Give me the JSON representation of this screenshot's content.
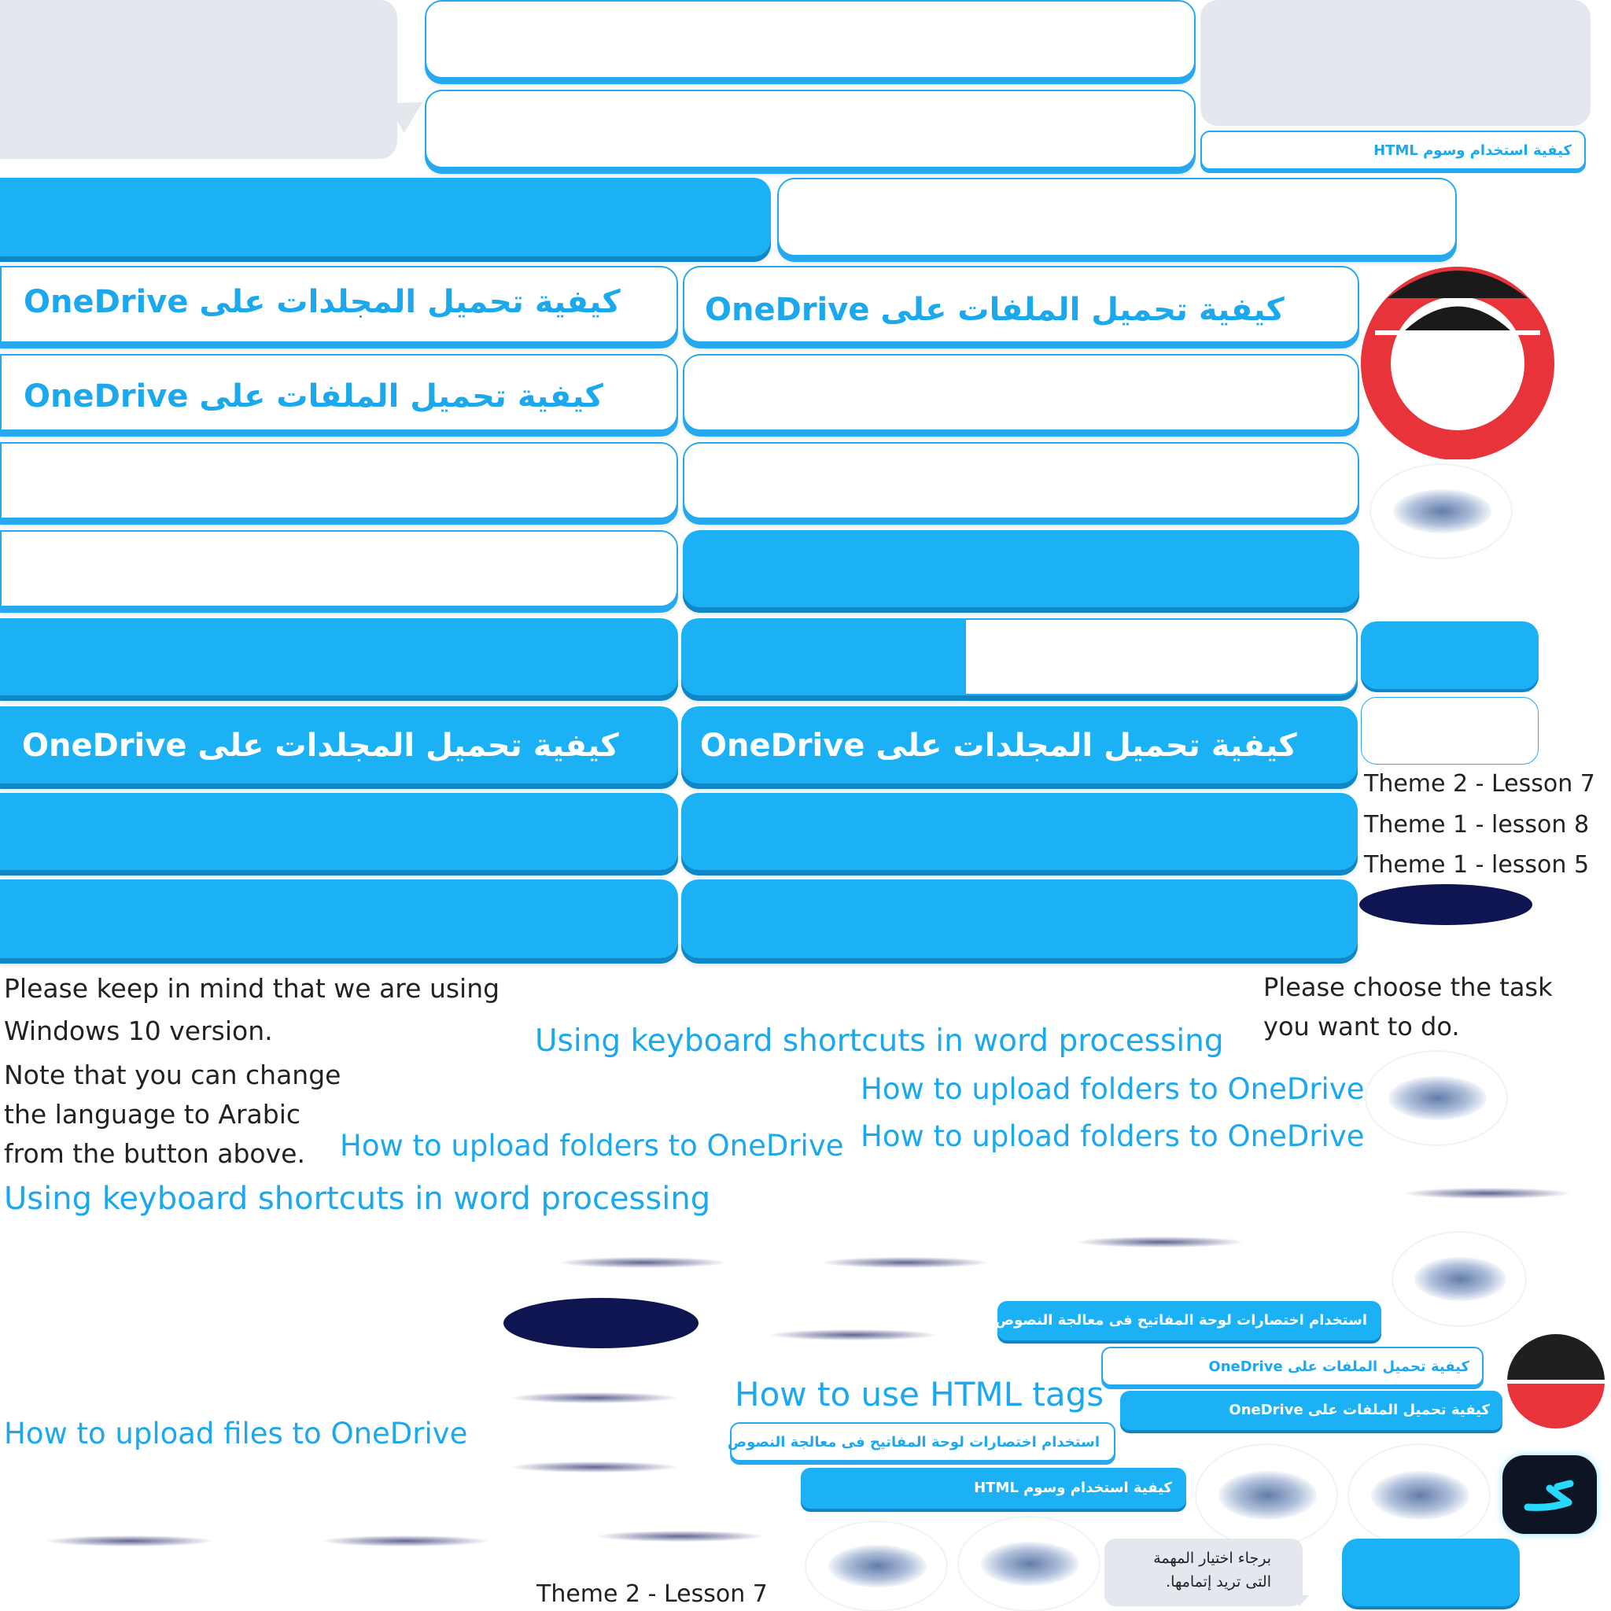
{
  "colors": {
    "accent": "#1cb0f5",
    "accent_dark": "#0f86c7",
    "navy": "#0f1550",
    "red": "#e8333b",
    "dark": "#222222",
    "gray_bubble": "#e4e8ee"
  },
  "buttons_large": {
    "folders_1": "كيفية تحميل المجلدات على OneDrive",
    "files_1": "كيفية تحميل الملفات على OneDrive",
    "files_2": "كيفية تحميل الملفات على OneDrive",
    "folders_blue_1": "كيفية تحميل المجلدات على OneDrive",
    "folders_blue_2": "كيفية تحميل المجلدات على OneDrive"
  },
  "buttons_small": {
    "html_top": "كيفية استخدام وسوم HTML",
    "shortcuts_blue": "استخدام اختصارات لوحة المفاتيح فى معالجة النصوص",
    "files_white": "كيفية تحميل الملفات على OneDrive",
    "files_blue": "كيفية تحميل الملفات على OneDrive",
    "shortcuts_white": "استخدام اختصارات لوحة المفاتيح فى معالجة النصوص",
    "html_blue": "كيفية استخدام وسوم HTML"
  },
  "lessons": {
    "l1": "Theme 2 - Lesson 7",
    "l2": "Theme 1 -  lesson 8",
    "l3": "Theme 1 -  lesson 5",
    "bottom": "Theme 2 - Lesson 7"
  },
  "notes": {
    "line1": "Please keep in mind that we are using",
    "line2": "Windows 10 version.",
    "line3": "Note that you can change",
    "line4": "the language to Arabic",
    "line5": "from the button above.",
    "choose1": "Please choose the task",
    "choose2": "you want to do."
  },
  "labels": {
    "shortcuts_1": "Using keyboard shortcuts in word processing",
    "shortcuts_2": "Using keyboard shortcuts in word processing",
    "folders_1": "How to upload folders to OneDrive",
    "folders_2": "How to upload folders to OneDrive",
    "folders_3": "How to upload folders to OneDrive",
    "files": "How to upload files to OneDrive",
    "html": "How to use HTML tags"
  },
  "speech_ar": {
    "line1": "برجاء اختيار المهمة",
    "line2": "التى تريد إتمامها."
  },
  "icons": [
    "profile-ring-icon",
    "language-toggle-icon",
    "blurred-avatar-icon",
    "shadow-line-icon",
    "navy-ellipse-icon"
  ]
}
